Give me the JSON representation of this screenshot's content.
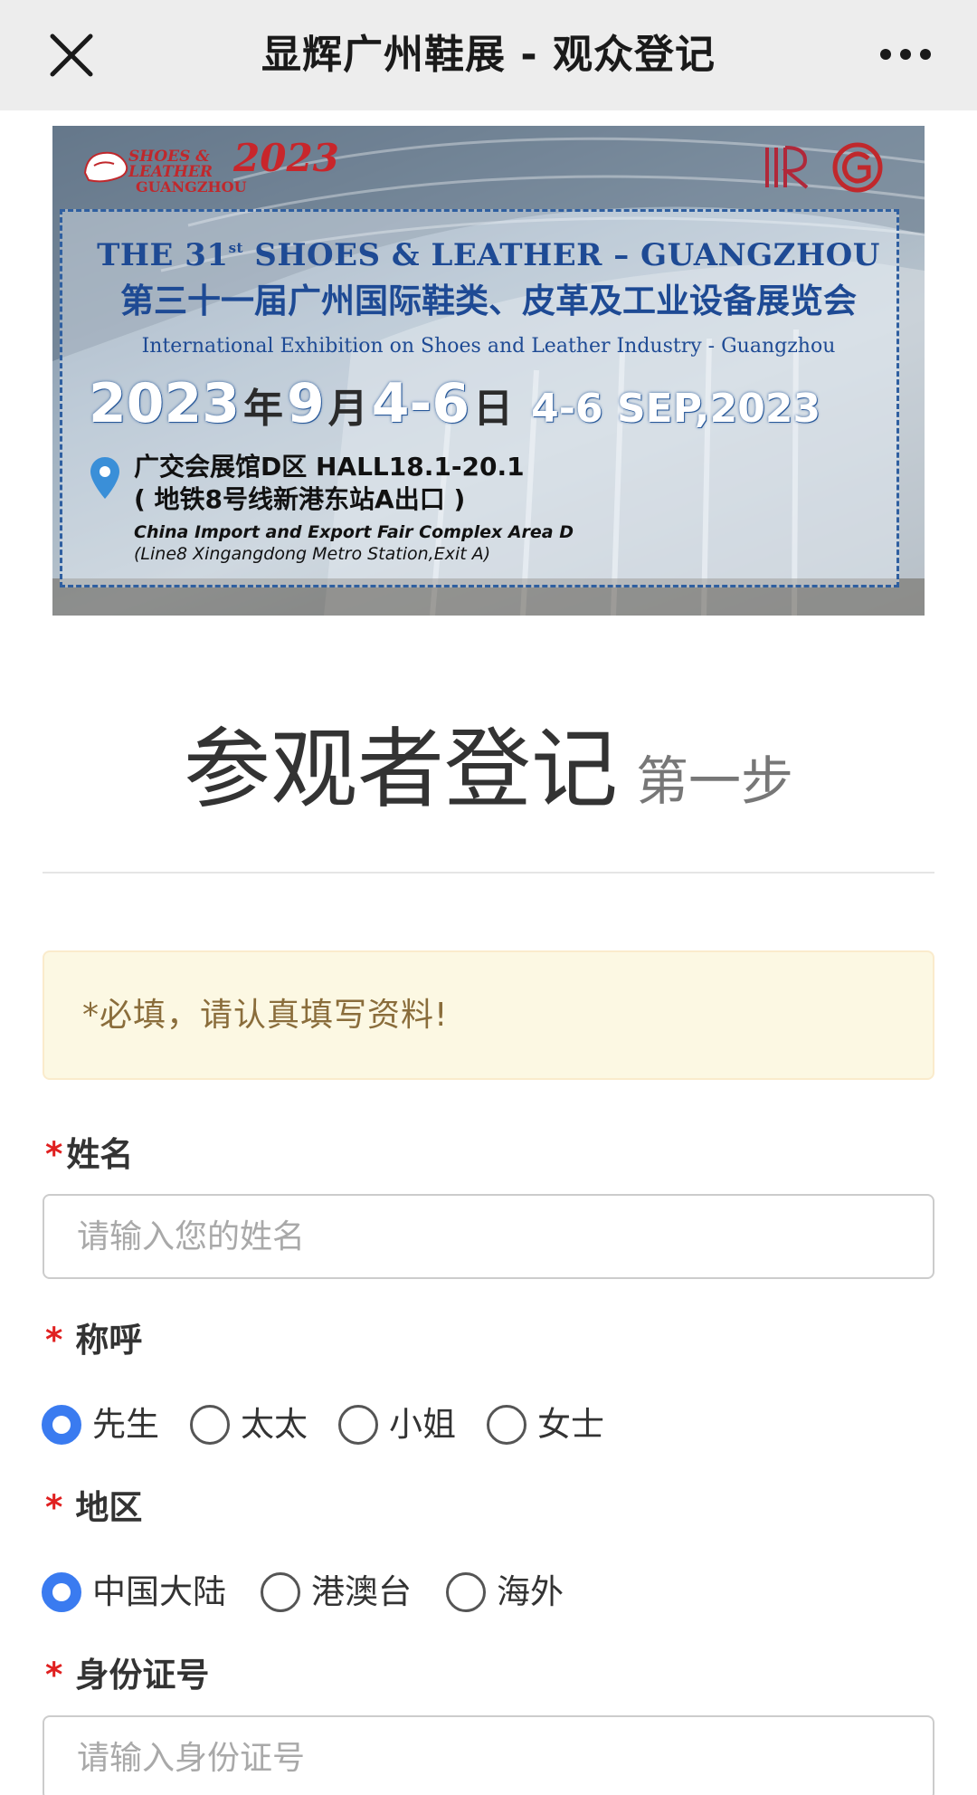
{
  "nav": {
    "title": "显辉广州鞋展 - 观众登记"
  },
  "banner": {
    "logo_text_line1": "SHOES &",
    "logo_text_line2": "LEATHER",
    "logo_text_line3": "GUANGZHOU",
    "logo_year": "2023",
    "title_en_prefix": "THE 31",
    "title_en_sup": "st",
    "title_en_suffix": " SHOES & LEATHER – GUANGZHOU",
    "title_cn": "第三十一届广州国际鞋类、皮革及工业设备展览会",
    "subtitle_en": "International Exhibition on Shoes and Leather Industry - Guangzhou",
    "date": {
      "year": "2023",
      "year_unit": "年",
      "month": "9",
      "month_unit": "月",
      "days": "4-6",
      "day_unit": "日",
      "en": "4-6 SEP,2023"
    },
    "address_cn_1": "广交会展馆D区 HALL18.1-20.1",
    "address_cn_2": "( 地铁8号线新港东站A出口 )",
    "address_en_1": "China Import and Export Fair Complex Area D",
    "address_en_2": "(Line8 Xingangdong Metro Station,Exit A)"
  },
  "heading": {
    "title": "参观者登记",
    "step": "第一步"
  },
  "notice": {
    "text": "*必填，请认真填写资料!"
  },
  "form": {
    "required_mark": "*",
    "name": {
      "label": "姓名",
      "placeholder": "请输入您的姓名",
      "value": ""
    },
    "salutation": {
      "label": "称呼",
      "options": [
        "先生",
        "太太",
        "小姐",
        "女士"
      ],
      "selected": "先生"
    },
    "region": {
      "label": "地区",
      "options": [
        "中国大陆",
        "港澳台",
        "海外"
      ],
      "selected": "中国大陆"
    },
    "id_number": {
      "label": "身份证号",
      "placeholder": "请输入身份证号",
      "value": ""
    }
  },
  "colors": {
    "nav_bg": "#ededed",
    "radio_checked": "#3a7bf0",
    "required": "#e02020",
    "notice_bg": "#fcf8e3",
    "notice_text": "#8a6d3b",
    "banner_blue": "#1e4a94"
  }
}
